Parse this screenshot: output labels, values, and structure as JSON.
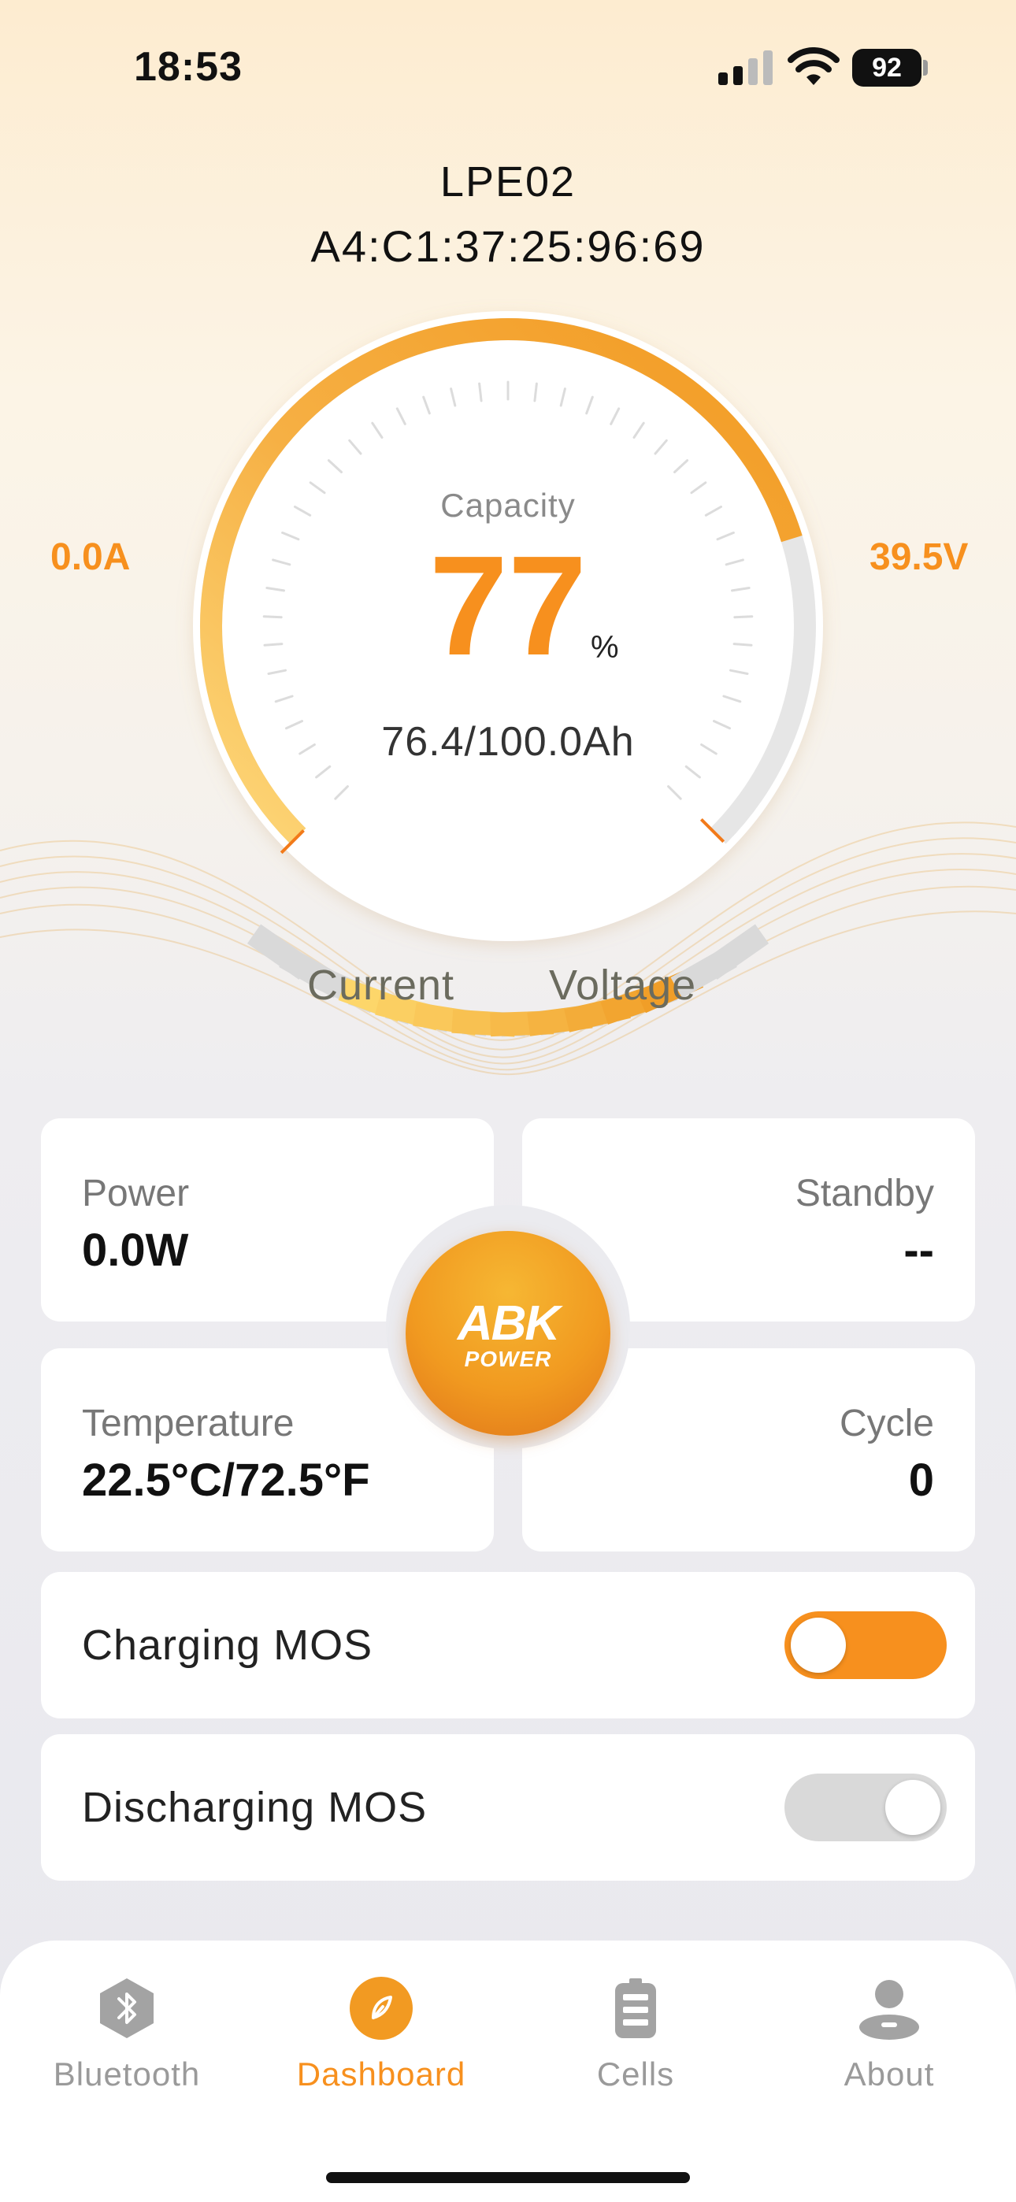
{
  "status_bar": {
    "time": "18:53",
    "battery_level": "92"
  },
  "device": {
    "name": "LPE02",
    "mac": "A4:C1:37:25:96:69"
  },
  "gauge": {
    "capacity_label": "Capacity",
    "capacity_value": "77",
    "capacity_percent": 0.77,
    "capacity_unit": "%",
    "capacity_ah": "76.4/100.0Ah",
    "current_value": "0.0A",
    "current_label": "Current",
    "voltage_value": "39.5V",
    "voltage_label": "Voltage",
    "current_bars_filled": 0,
    "voltage_bars_filled": 9,
    "bars_total": 11
  },
  "stats": {
    "power_label": "Power",
    "power_value": "0.0W",
    "standby_label": "Standby",
    "standby_value": "--",
    "temperature_label": "Temperature",
    "temperature_value": "22.5°C/72.5°F",
    "cycle_label": "Cycle",
    "cycle_value": "0"
  },
  "logo_text": "ABK POWER",
  "controls": {
    "charging_label": "Charging MOS",
    "charging_on": true,
    "discharging_label": "Discharging MOS",
    "discharging_on": false
  },
  "tabs": [
    {
      "label": "Bluetooth",
      "icon": "bluetooth-icon"
    },
    {
      "label": "Dashboard",
      "icon": "dashboard-icon",
      "active": true
    },
    {
      "label": "Cells",
      "icon": "battery-cells-icon"
    },
    {
      "label": "About",
      "icon": "person-icon"
    }
  ],
  "colors": {
    "accent": "#f7901e",
    "accent_light": "#fdd66a",
    "inactive": "#d9d9d9"
  }
}
